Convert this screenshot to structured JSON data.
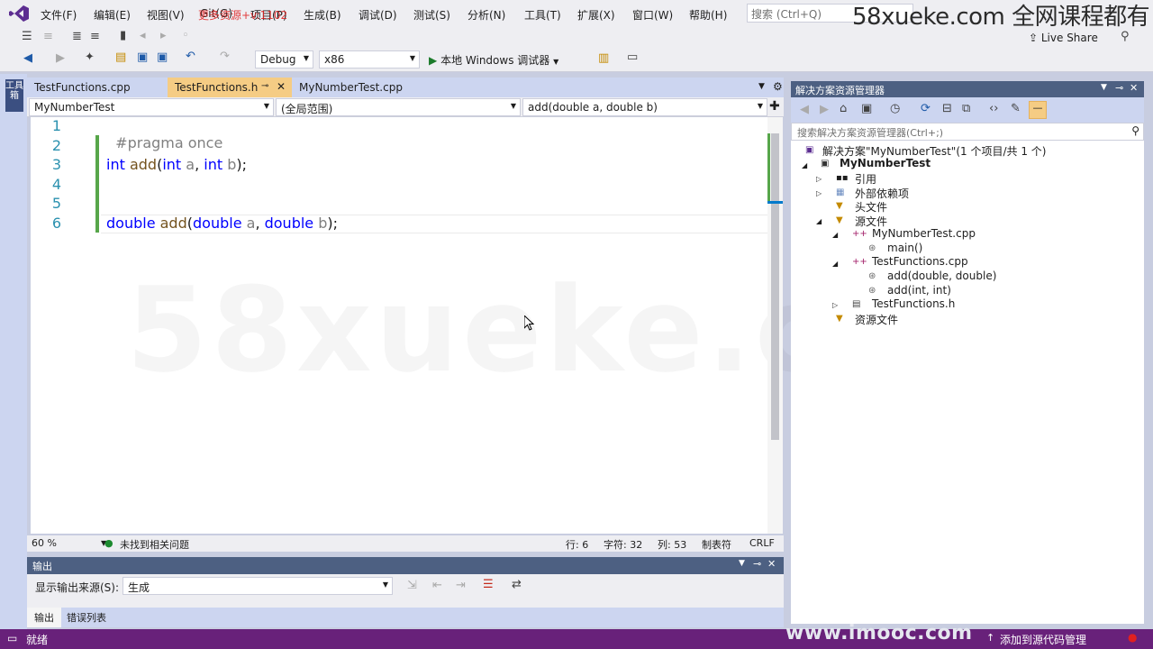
{
  "menu": {
    "items": [
      "文件(F)",
      "编辑(E)",
      "视图(V)",
      "Git(G)",
      "项目(P)",
      "生成(B)",
      "调试(D)",
      "测试(S)",
      "分析(N)",
      "工具(T)",
      "扩展(X)",
      "窗口(W)",
      "帮助(H)"
    ],
    "search_placeholder": "搜索 (Ctrl+Q)",
    "overlay_red": "更多资源+v:1102",
    "live_share": "Live Share"
  },
  "watermarks": {
    "top": "58xueke.com 全网课程都有",
    "center": "58xueke.com",
    "bottom": "www.imooc.com"
  },
  "toolbar": {
    "config": "Debug",
    "platform": "x86",
    "run_label": "本地 Windows 调试器"
  },
  "toolbox_label": "工具箱",
  "tabs": [
    {
      "label": "TestFunctions.cpp",
      "active": false
    },
    {
      "label": "TestFunctions.h",
      "active": true
    },
    {
      "label": "MyNumberTest.cpp",
      "active": false
    }
  ],
  "nav": {
    "project": "MyNumberTest",
    "scope": "(全局范围)",
    "member": "add(double a, double b)"
  },
  "code": {
    "line_numbers": [
      "1",
      "2",
      "3",
      "4",
      "5",
      "6"
    ],
    "line1": "#pragma once",
    "line3": {
      "t1": "int",
      "f": "add",
      "p1": "(",
      "t2": "int",
      "a": "a",
      "c": ", ",
      "t3": "int",
      "b": "b",
      "end": ");"
    },
    "line6": {
      "t1": "double",
      "f": "add",
      "p1": "(",
      "t2": "double",
      "a": "a",
      "c": ", ",
      "t3": "double",
      "b": "b",
      "end": ");"
    }
  },
  "editor_status": {
    "zoom": "60 %",
    "issues": "未找到相关问题",
    "line": "行: 6",
    "char": "字符: 32",
    "col": "列: 53",
    "tab": "制表符",
    "eol": "CRLF"
  },
  "output": {
    "title": "输出",
    "source_label": "显示输出来源(S):",
    "source_value": "生成",
    "tab_output": "输出",
    "tab_errors": "错误列表"
  },
  "solution_explorer": {
    "title": "解决方案资源管理器",
    "search_placeholder": "搜索解决方案资源管理器(Ctrl+;)",
    "solution": "解决方案\"MyNumberTest\"(1 个项目/共 1 个)",
    "project": "MyNumberTest",
    "references": "引用",
    "external_deps": "外部依赖项",
    "header_files": "头文件",
    "source_files": "源文件",
    "file_main_cpp": "MyNumberTest.cpp",
    "fn_main": "main()",
    "file_testfunctions_cpp": "TestFunctions.cpp",
    "fn_add_double": "add(double, double)",
    "fn_add_int": "add(int, int)",
    "file_testfunctions_h": "TestFunctions.h",
    "resource_files": "资源文件"
  },
  "statusbar": {
    "ready": "就绪",
    "add_source": "添加到源代码管理"
  },
  "colors": {
    "accent": "#68217a",
    "active_tab": "#f5cc84",
    "keyword": "#0000ff",
    "function": "#74531f",
    "line_number": "#2b91af"
  }
}
